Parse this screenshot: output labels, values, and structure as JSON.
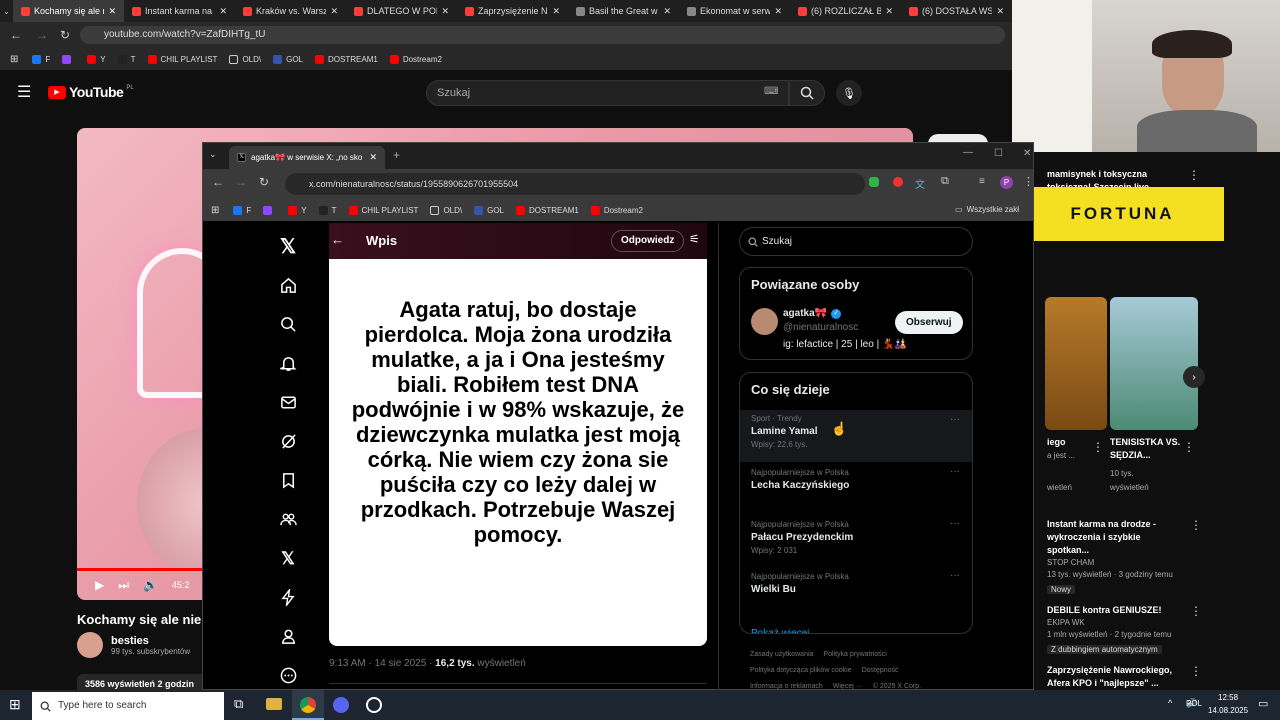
{
  "outer_browser": {
    "tabs": [
      {
        "label": "Kochamy się ale na",
        "active": true
      },
      {
        "label": "Instant karma na"
      },
      {
        "label": "Kraków vs. Warsz"
      },
      {
        "label": "DLATEGO W POL"
      },
      {
        "label": "Zaprzysiężenie N"
      },
      {
        "label": "Basil the Great w"
      },
      {
        "label": "Ekonomat w serw"
      },
      {
        "label": "(6) ROZLICZAŁ BR"
      },
      {
        "label": "(6) DOSTAŁA WSP"
      }
    ],
    "url": "youtube.com/watch?v=ZafDIHTg_tU",
    "bookmarks": [
      "F",
      "",
      "Y",
      "T",
      "CHIL PLAYLIST",
      "OLD\\",
      "GOL",
      "DOSTREAM1",
      "Dostream2"
    ]
  },
  "youtube": {
    "logo": "YouTube",
    "logo_region": "PL",
    "search_placeholder": "Szukaj",
    "video_time": "45:2",
    "video_title": "Kochamy się ale nie r",
    "channel_name": "besties",
    "channel_subs": "99 tys. subskrybentów",
    "video_stats": "3586 wyświetleń 2 godzin",
    "right_top_text": "mamisynek i toksyczna",
    "right_top_text2": "toksiczna! Szczecin live",
    "ad_text": "FORTUNA",
    "cards": [
      {
        "title": "iego",
        "sub1": "a jest ...",
        "sub2": "wietleń"
      },
      {
        "title": "TENISISTKA VS. SĘDZIA...",
        "sub1": "10 tys.",
        "sub2": "wyświetleń"
      }
    ],
    "list": [
      {
        "title": "Instant karma na drodze - wykroczenia i szybkie spotkan...",
        "channel": "STOP CHAM",
        "meta": "13 tys. wyświetleń · 3 godziny temu",
        "badge": "Nowy"
      },
      {
        "title": "DEBILE kontra GENIUSZE!",
        "channel": "EKIPA WK",
        "meta": "1 mln wyświetleń · 2 tygodnie temu",
        "badge": "Z dubbingiem automatycznym"
      },
      {
        "title": "Zaprzysiężenie Nawrockiego, Afera KPO i \"najlepsze\" ...",
        "channel": "",
        "meta": "",
        "badge": ""
      }
    ]
  },
  "inner_browser": {
    "tab_title": "agatka🎀 w serwisie X: „no sko",
    "url": "x.com/nienaturalnosc/status/1955890626701955504",
    "bookmarks": [
      "F",
      "",
      "Y",
      "T",
      "CHIL PLAYLIST",
      "OLD\\",
      "GOL",
      "DOSTREAM1",
      "Dostream2"
    ],
    "all_bookmarks": "Wszystkie zakł"
  },
  "x": {
    "header_title": "Wpis",
    "reply_button": "Odpowiedz",
    "post_text": "Agata ratuj, bo dostaje pierdolca. Moja żona urodziła mulatke, a ja i Ona jesteśmy biali. Robiłem test DNA podwójnie i w 98% wskazuje, że dziewczynka mulatka jest moją córką. Nie wiem czy żona sie puściła czy co leży dalej w przodkach. Potrzebuje Waszej pomocy.",
    "post_time": "9:13 AM · 14 sie 2025 · ",
    "post_views": "16,2 tys.",
    "post_views_label": " wyświetleń",
    "search_placeholder": "Szukaj",
    "related_title": "Powiązane osoby",
    "related_name": "agatka🎀",
    "related_handle": "@nienaturalnosc",
    "related_bio": "ig: lefactice | 25 | leo | 💃🎎",
    "follow_button": "Obserwuj",
    "trends_title": "Co się dzieje",
    "trends": [
      {
        "category": "Sport · Trendy",
        "name": "Lamine Yamal",
        "count": "Wpisy: 22,6 tys."
      },
      {
        "category": "Najpopularniejsze w Polska",
        "name": "Lecha Kaczyńskiego",
        "count": ""
      },
      {
        "category": "Najpopularniejsze w Polska",
        "name": "Pałacu Prezydenckim",
        "count": "Wpisy: 2 031"
      },
      {
        "category": "Najpopularniejsze w Polska",
        "name": "Wielki Bu",
        "count": ""
      }
    ],
    "show_more": "Pokaż więcej",
    "footer": [
      "Zasady użytkowania",
      "Polityka prywatności",
      "Polityka dotycząca plików cookie",
      "Dostępność",
      "Informacja o reklamach",
      "Więcej ···",
      "© 2025 X Corp."
    ]
  },
  "taskbar": {
    "search_placeholder": "Type here to search",
    "lang": "POL",
    "time": "12:58",
    "date": "14.08.2025"
  }
}
